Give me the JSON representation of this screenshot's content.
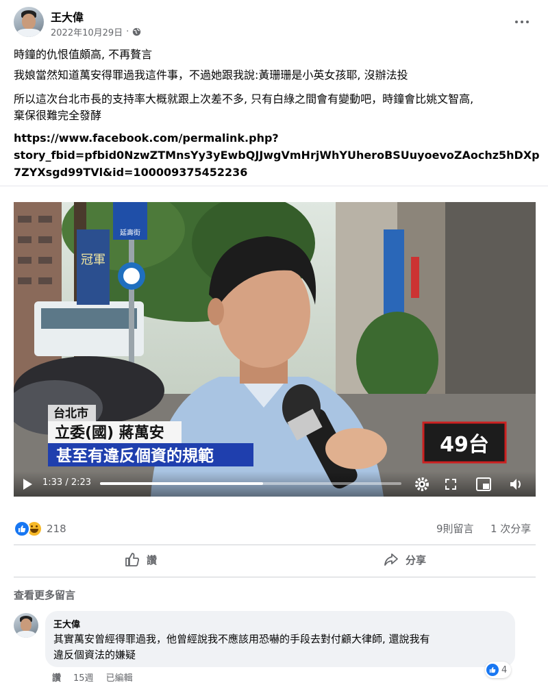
{
  "post": {
    "author": "王大偉",
    "date": "2022年10月29日",
    "dot": "·",
    "paragraphs": [
      "時鐘的仇恨值頗高, 不再贅言",
      "我娘當然知道萬安得罪過我這件事，不過她跟我說:黃珊珊是小英女孩耶, 沒辦法投",
      "所以這次台北市長的支持率大概就跟上次差不多, 只有白綠之間會有變動吧，時鐘會比姚文智高,",
      "棄保很難完全發酵"
    ],
    "link_lines": [
      "https://www.facebook.com/permalink.php?",
      "story_fbid=pfbid0NzwZTMnsYy3yEwbQJJwgVmHrjWhYUheroBSUuyoevoZAochz5hDXp",
      "7ZYXsgd99TVl&id=100009375452236"
    ]
  },
  "video": {
    "location_tag": "台北市",
    "speaker_tag": "立委(國) 蔣萬安",
    "subtitle": "甚至有違反個資的規範",
    "channel_logo": "49台",
    "time": "1:33 / 2:23",
    "progress": 0.54,
    "sign_text": "延壽街",
    "store_text": "冠軍"
  },
  "stats": {
    "reactions_count": "218",
    "comments": "9則留言",
    "shares": "1 次分享"
  },
  "actions": {
    "like": "讚",
    "share": "分享"
  },
  "comments_section": {
    "more": "查看更多留言",
    "comment": {
      "author": "王大偉",
      "text_line1": "其實萬安曾經得罪過我，他曾經說我不應該用恐嚇的手段去對付顧大律師, 還說我有",
      "text_line2": "違反個資法的嫌疑",
      "reaction_count": "4",
      "like": "讚",
      "time": "15週",
      "edited": "已編輯"
    }
  },
  "colors": {
    "like_blue": "#1877f2",
    "haha_yellow": "#f7b928",
    "subtitle_bg": "#1f3fae",
    "progress_blue": "#1877f2"
  },
  "icons": {
    "more": "more-dots-icon",
    "globe": "globe-icon",
    "play": "play-icon",
    "settings": "gear-icon",
    "fullscreen": "expand-icon",
    "pip": "picture-in-picture-icon",
    "volume": "volume-icon",
    "like": "thumbs-up-icon",
    "share": "share-arrow-icon"
  }
}
